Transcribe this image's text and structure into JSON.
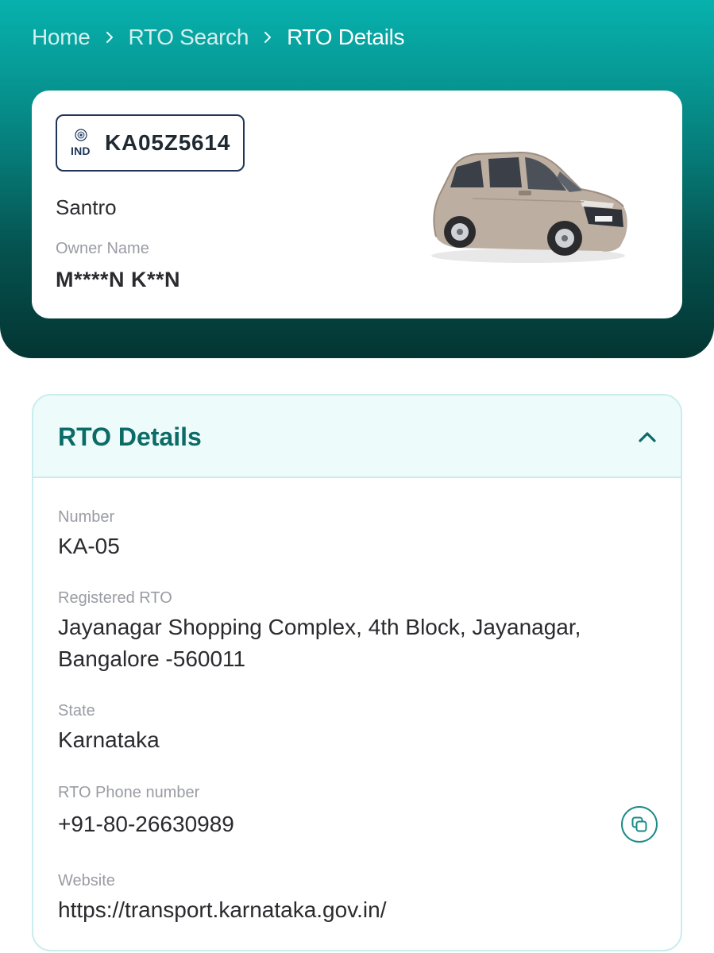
{
  "breadcrumb": {
    "home": "Home",
    "search": "RTO Search",
    "current": "RTO Details"
  },
  "vehicle": {
    "plate_country": "IND",
    "plate_number": "KA05Z5614",
    "model": "Santro",
    "owner_label": "Owner Name",
    "owner_name": "M****N K**N"
  },
  "rto": {
    "title": "RTO Details",
    "number_label": "Number",
    "number_value": "KA-05",
    "registered_label": "Registered RTO",
    "registered_value": "Jayanagar Shopping Complex, 4th Block, Jayanagar, Bangalore -560011",
    "state_label": "State",
    "state_value": "Karnataka",
    "phone_label": "RTO Phone number",
    "phone_value": "+91-80-26630989",
    "website_label": "Website",
    "website_value": "https://transport.karnataka.gov.in/"
  },
  "icons": {
    "breadcrumb_separator": "chevron-right-icon",
    "collapse": "chevron-up-icon",
    "copy": "copy-icon",
    "emblem": "national-emblem-icon"
  },
  "colors": {
    "brand_teal": "#07b1ad",
    "header_title": "#0b6b67",
    "plate_border": "#1f3556"
  }
}
